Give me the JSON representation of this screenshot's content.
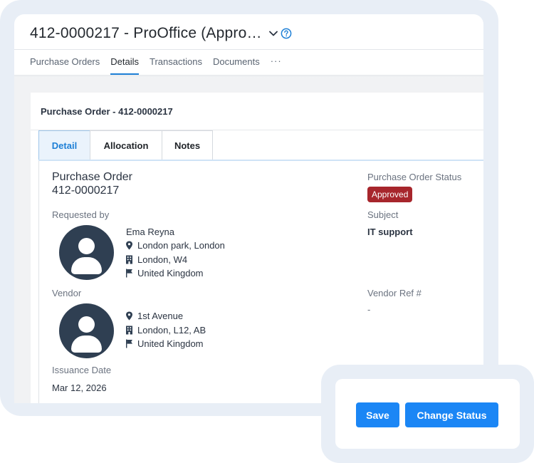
{
  "header": {
    "title": "412-0000217 - ProOffice (Appro…"
  },
  "tabs": [
    {
      "label": "Purchase Orders"
    },
    {
      "label": "Details"
    },
    {
      "label": "Transactions"
    },
    {
      "label": "Documents"
    }
  ],
  "tabs_more": "···",
  "card": {
    "title": "Purchase Order - 412-0000217",
    "inner_tabs": [
      {
        "label": "Detail"
      },
      {
        "label": "Allocation"
      },
      {
        "label": "Notes"
      }
    ]
  },
  "detail": {
    "po_heading": "Purchase Order",
    "po_number": "412-0000217",
    "status_label": "Purchase Order Status",
    "status_value": "Approved",
    "requested_by_label": "Requested by",
    "requester": {
      "name": "Ema Reyna",
      "street": "London park, London",
      "city": "London, W4",
      "country": "United Kingdom"
    },
    "subject_label": "Subject",
    "subject_value": "IT support",
    "vendor_label": "Vendor",
    "vendor": {
      "street": "1st Avenue",
      "city": "London, L12, AB",
      "country": "United Kingdom"
    },
    "vendor_ref_label": "Vendor Ref #",
    "vendor_ref_value": "-",
    "issuance_label": "Issuance Date",
    "issuance_value": "Mar 12, 2026"
  },
  "actions": {
    "save": "Save",
    "change_status": "Change Status"
  },
  "colors": {
    "accent": "#1b86f5",
    "status_approved": "#a7262c",
    "avatar": "#2f3f52",
    "frame": "#e8eef6"
  }
}
